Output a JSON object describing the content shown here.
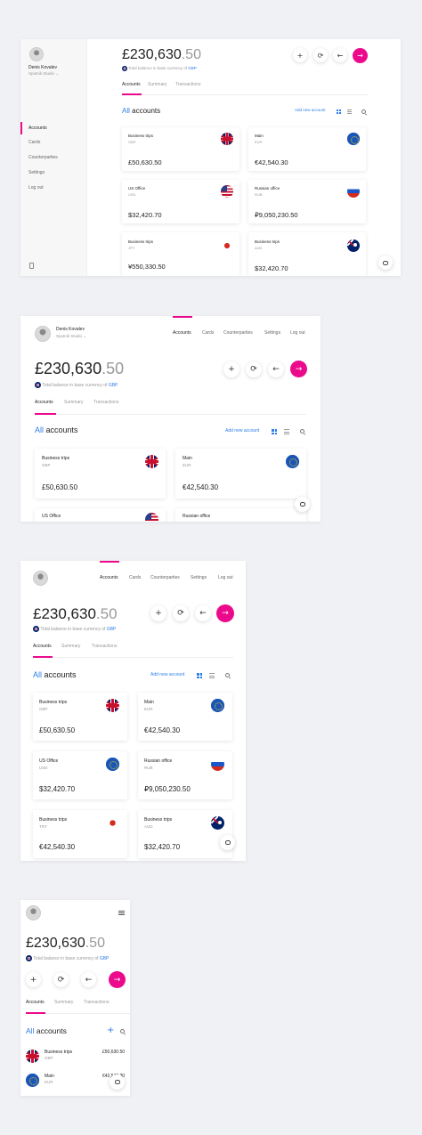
{
  "user": {
    "name": "Denis Kovalev",
    "company": "Sputnik Studio"
  },
  "nav": [
    "Accounts",
    "Cards",
    "Counterparties",
    "Settings",
    "Log out"
  ],
  "balance": {
    "main": "£230,630",
    "dec": ".50",
    "sub_text": "Total balance in base currency of",
    "currency": "GBP"
  },
  "tabs": [
    "Accounts",
    "Summary",
    "Transactions"
  ],
  "section": {
    "all": "All",
    "accounts": "accounts",
    "add_label": "Add new account"
  },
  "icons": {
    "add": "+",
    "refresh": "⟳",
    "back": "←",
    "forward": "→",
    "chevron": "⌄"
  },
  "accent": "#ec0a8c",
  "link_color": "#2b7de9",
  "cards": [
    {
      "name": "Business trips",
      "currency": "GBP",
      "amount": "£50,630.50",
      "flag": "uk-flag"
    },
    {
      "name": "Main",
      "currency": "EUR",
      "amount": "€42,540.30",
      "flag": "eu-flag"
    },
    {
      "name": "US Office",
      "currency": "USD",
      "amount": "$32,420.70",
      "flag": "us-flag"
    },
    {
      "name": "Russian office",
      "currency": "RUB",
      "amount": "₽9,050,230.50",
      "flag": "ru-flag"
    },
    {
      "name": "Business trips",
      "currency": "JPY",
      "amount": "¥550,330.50",
      "flag": "jp-flag"
    },
    {
      "name": "Business trips",
      "currency": "AUD",
      "amount": "$32,420.70",
      "flag": "au-flag"
    }
  ],
  "tablet_cards": [
    {
      "name": "Business trips",
      "currency": "GBP",
      "amount": "£50,630.50"
    },
    {
      "name": "Main",
      "currency": "EUR",
      "amount": "€42,540.30"
    },
    {
      "name": "US Office",
      "currency": "USD",
      "amount": "$32,420.70"
    },
    {
      "name": "Russian office",
      "currency": "RUB",
      "amount": "₽9,050,230.50"
    },
    {
      "name": "Business trips",
      "currency": "TRY",
      "amount": "€42,540.30"
    },
    {
      "name": "Business trips",
      "currency": "AUD",
      "amount": "$32,420.70"
    }
  ],
  "mobile_list": [
    {
      "name": "Business trips",
      "currency": "GBP",
      "amount": "£50,630.50"
    },
    {
      "name": "Main",
      "currency": "EUR",
      "amount": "€42,540.30"
    }
  ]
}
